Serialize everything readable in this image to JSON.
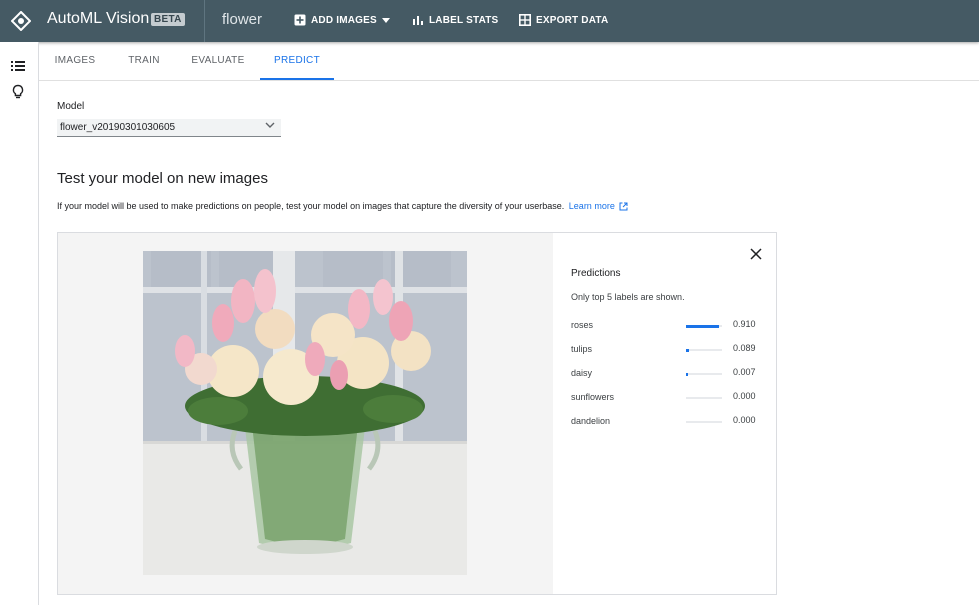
{
  "header": {
    "app_title": "AutoML Vision",
    "badge": "BETA",
    "dataset": "flower",
    "actions": [
      {
        "label": "ADD IMAGES",
        "icon": "plus-box-icon",
        "has_dropdown": true
      },
      {
        "label": "LABEL STATS",
        "icon": "bar-chart-icon"
      },
      {
        "label": "EXPORT DATA",
        "icon": "grid-table-icon"
      }
    ],
    "colors": {
      "bar": "#455a64",
      "accent": "#1a73e8"
    }
  },
  "rail": {
    "icons": [
      "list-icon",
      "lightbulb-icon"
    ]
  },
  "tabs": [
    {
      "label": "IMAGES",
      "active": false
    },
    {
      "label": "TRAIN",
      "active": false
    },
    {
      "label": "EVALUATE",
      "active": false
    },
    {
      "label": "PREDICT",
      "active": true
    }
  ],
  "model": {
    "label": "Model",
    "selected": "flower_v20190301030605"
  },
  "test": {
    "heading": "Test your model on new images",
    "description": "If your model will be used to make predictions on people, test your model on images that capture the diversity of your userbase.",
    "learn_more": "Learn more"
  },
  "predictions": {
    "title": "Predictions",
    "note": "Only top 5 labels are shown.",
    "items": [
      {
        "label": "roses",
        "score": "0.910",
        "value": 0.91
      },
      {
        "label": "tulips",
        "score": "0.089",
        "value": 0.089
      },
      {
        "label": "daisy",
        "score": "0.007",
        "value": 0.007
      },
      {
        "label": "sunflowers",
        "score": "0.000",
        "value": 0.0
      },
      {
        "label": "dandelion",
        "score": "0.000",
        "value": 0.0
      }
    ]
  }
}
